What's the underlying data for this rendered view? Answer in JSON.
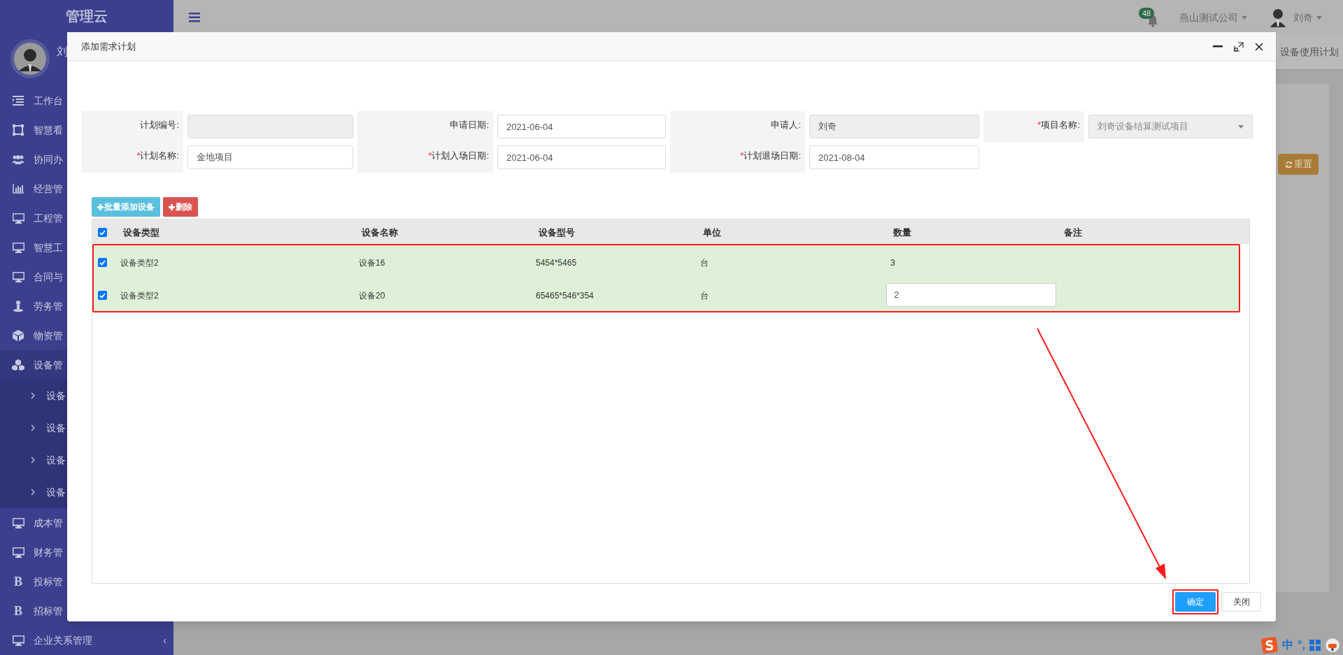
{
  "sidebar": {
    "logo": "管理云",
    "user_name": "刘",
    "items": [
      {
        "label": "工作台",
        "expanded": false
      },
      {
        "label": "智慧看",
        "expanded": false
      },
      {
        "label": "协同办",
        "expanded": false
      },
      {
        "label": "经营管",
        "expanded": false
      },
      {
        "label": "工程管",
        "expanded": false
      },
      {
        "label": "智慧工",
        "expanded": false
      },
      {
        "label": "合同与",
        "expanded": false
      },
      {
        "label": "劳务管",
        "expanded": false
      },
      {
        "label": "物资管",
        "expanded": false
      },
      {
        "label": "设备管",
        "expanded": true,
        "children": [
          {
            "label": "设备"
          },
          {
            "label": "设备"
          },
          {
            "label": "设备"
          },
          {
            "label": "设备"
          }
        ]
      },
      {
        "label": "成本管",
        "expanded": false
      },
      {
        "label": "财务管",
        "expanded": false
      },
      {
        "label": "投标管",
        "expanded": false,
        "glyph": "B"
      },
      {
        "label": "招标管",
        "expanded": false,
        "glyph": "B"
      },
      {
        "label": "企业关系管理",
        "expanded": false,
        "caret": "‹"
      }
    ]
  },
  "top_bar": {
    "notification_count": "48",
    "company": "燕山测试公司",
    "user": "刘奇"
  },
  "background_page": {
    "tab": "设备使用计划",
    "reset_button": "重置"
  },
  "modal": {
    "title": "添加需求计划",
    "fields": [
      {
        "label": "计划编号:",
        "kind": "input",
        "disabled": true
      },
      {
        "label": "申请日期:",
        "kind": "input",
        "disabled": false,
        "value": "2021-06-04"
      },
      {
        "label": "申请人:",
        "kind": "input",
        "disabled": true,
        "value": "刘奇"
      },
      {
        "label": "项目名称:",
        "required_mark": "*",
        "kind": "select",
        "disabled": true,
        "value": "刘奇设备结算测试项目"
      },
      {
        "label": "计划名称:",
        "required_mark": "*",
        "kind": "input",
        "disabled": false,
        "value": "金地项目"
      },
      {
        "label": "计划入场日期:",
        "required_mark": "*",
        "kind": "input",
        "disabled": false,
        "value": "2021-06-04"
      },
      {
        "label": "计划退场日期:",
        "required_mark": "*",
        "kind": "input",
        "disabled": false,
        "value": "2021-08-04"
      }
    ],
    "toolbar": [
      {
        "label": "批量添加设备",
        "kind": "info"
      },
      {
        "label": "删除",
        "kind": "danger"
      }
    ],
    "table": {
      "all_selected": true,
      "columns": [
        "设备类型",
        "设备名称",
        "设备型号",
        "单位",
        "数量",
        "备注"
      ],
      "rows": [
        {
          "selected": true,
          "editing": false,
          "cells": [
            "设备类型2",
            "设备16",
            "5454*5465",
            "台",
            "3"
          ]
        },
        {
          "selected": true,
          "editing": true,
          "cells": [
            "设备类型2",
            "设备20",
            "65465*546*354",
            "台",
            "2"
          ]
        }
      ]
    },
    "buttons": [
      {
        "label": "确定",
        "kind": "primary"
      },
      {
        "label": "关闭",
        "kind": "default"
      }
    ]
  },
  "ime_bar": {
    "mode": "中",
    "punctuation": "°,"
  }
}
